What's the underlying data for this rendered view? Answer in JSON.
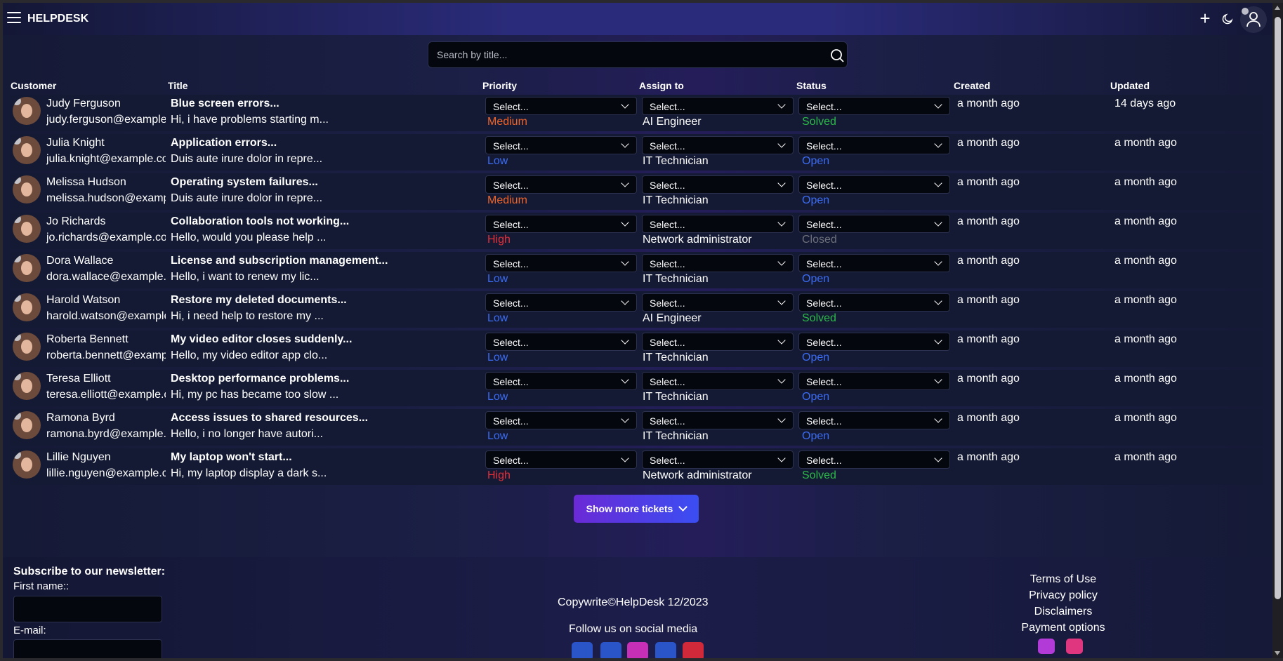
{
  "app": {
    "brand": "HELPDESK"
  },
  "search": {
    "placeholder": "Search by title..."
  },
  "table": {
    "headers": [
      "Customer",
      "Title",
      "Priority",
      "Assign to",
      "Status",
      "Created",
      "Updated"
    ],
    "select_placeholder": "Select...",
    "rows": [
      {
        "name": "Judy Ferguson",
        "email": "judy.ferguson@example.com",
        "title": "Blue screen errors...",
        "desc": "Hi, i have problems starting m...",
        "priority": "Medium",
        "assign": "AI Engineer",
        "status": "Solved",
        "created": "a month ago",
        "updated": "14 days ago"
      },
      {
        "name": "Julia Knight",
        "email": "julia.knight@example.com",
        "title": "Application errors...",
        "desc": "Duis aute irure dolor in repre...",
        "priority": "Low",
        "assign": "IT Technician",
        "status": "Open",
        "created": "a month ago",
        "updated": "a month ago"
      },
      {
        "name": "Melissa Hudson",
        "email": "melissa.hudson@example.com",
        "title": "Operating system failures...",
        "desc": "Duis aute irure dolor in repre...",
        "priority": "Medium",
        "assign": "IT Technician",
        "status": "Open",
        "created": "a month ago",
        "updated": "a month ago"
      },
      {
        "name": "Jo Richards",
        "email": "jo.richards@example.com",
        "title": "Collaboration tools not working...",
        "desc": "Hello, would you please help ...",
        "priority": "High",
        "assign": "Network administrator",
        "status": "Closed",
        "created": "a month ago",
        "updated": "a month ago"
      },
      {
        "name": "Dora Wallace",
        "email": "dora.wallace@example.com",
        "title": "License and subscription management...",
        "desc": "Hello, i want to renew my lic...",
        "priority": "Low",
        "assign": "IT Technician",
        "status": "Open",
        "created": "a month ago",
        "updated": "a month ago"
      },
      {
        "name": "Harold Watson",
        "email": "harold.watson@example.com",
        "title": "Restore my deleted documents...",
        "desc": "Hi, i need help to restore my ...",
        "priority": "Low",
        "assign": "AI Engineer",
        "status": "Solved",
        "created": "a month ago",
        "updated": "a month ago"
      },
      {
        "name": "Roberta Bennett",
        "email": "roberta.bennett@example.com",
        "title": "My video editor closes suddenly...",
        "desc": "Hello, my video editor app clo...",
        "priority": "Low",
        "assign": "IT Technician",
        "status": "Open",
        "created": "a month ago",
        "updated": "a month ago"
      },
      {
        "name": "Teresa Elliott",
        "email": "teresa.elliott@example.com",
        "title": "Desktop performance problems...",
        "desc": "Hi, my pc has became too slow ...",
        "priority": "Low",
        "assign": "IT Technician",
        "status": "Open",
        "created": "a month ago",
        "updated": "a month ago"
      },
      {
        "name": "Ramona Byrd",
        "email": "ramona.byrd@example.com",
        "title": "Access issues to shared resources...",
        "desc": "Hello, i no longer have autori...",
        "priority": "Low",
        "assign": "IT Technician",
        "status": "Open",
        "created": "a month ago",
        "updated": "a month ago"
      },
      {
        "name": "Lillie Nguyen",
        "email": "lillie.nguyen@example.com",
        "title": "My laptop won't start...",
        "desc": "Hi, my laptop display a dark s...",
        "priority": "High",
        "assign": "Network administrator",
        "status": "Solved",
        "created": "a month ago",
        "updated": "a month ago"
      }
    ]
  },
  "colors": {
    "priority": {
      "Low": "#3b6cf5",
      "Medium": "#f0642a",
      "High": "#e3303a"
    },
    "status": {
      "Open": "#3b6cf5",
      "Solved": "#2eb84b",
      "Closed": "#6d6f7a"
    },
    "accent_gradient": [
      "#6a2ad6",
      "#3a4ef2"
    ]
  },
  "show_more": {
    "label": "Show more tickets"
  },
  "footer": {
    "newsletter_title": "Subscribe to our newsletter:",
    "first_name_label": "First name::",
    "email_label": "E-mail:",
    "copyright": "Copywrite©HelpDesk 12/2023",
    "follow": "Follow us on social media",
    "social": [
      "linkedin-icon",
      "facebook-icon",
      "instagram-icon",
      "twitter-icon",
      "youtube-icon"
    ],
    "links": [
      "Terms of Use",
      "Privacy policy",
      "Disclaimers",
      "Payment options"
    ],
    "payment": [
      "card-icon-purple",
      "card-icon-pink"
    ]
  }
}
